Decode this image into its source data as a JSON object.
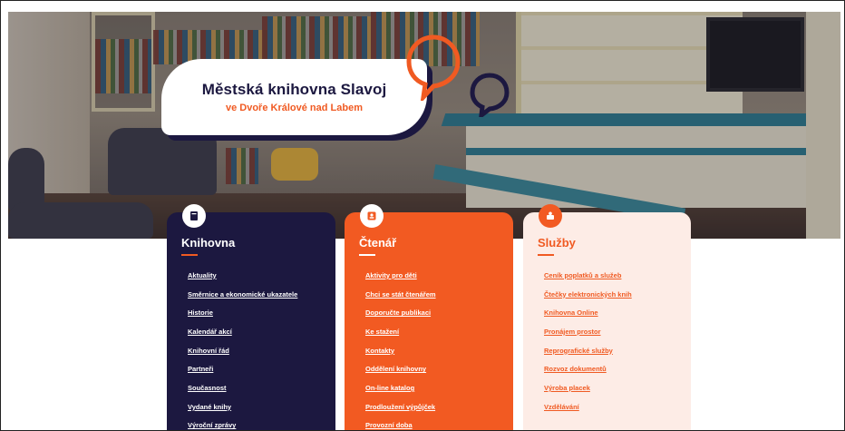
{
  "logo": {
    "title": "Městská knihovna Slavoj",
    "subtitle": "ve Dvoře Králové nad Labem"
  },
  "hero": {
    "image": "library-interior-photo"
  },
  "colors": {
    "navy": "#1c1840",
    "orange": "#f25a22",
    "peach": "#fdece6"
  },
  "sections": [
    {
      "title": "Knihovna",
      "icon": "book-icon",
      "links": [
        "Aktuality",
        "Směrnice a ekonomické ukazatele",
        "Historie",
        "Kalendář akcí",
        "Knihovní řád",
        "Partneři",
        "Současnost",
        "Vydané knihy",
        "Výroční zprávy"
      ]
    },
    {
      "title": "Čtenář",
      "icon": "reader-card-icon",
      "links": [
        "Aktivity pro děti",
        "Chci se stát čtenářem",
        "Doporučte publikaci",
        "Ke stažení",
        "Kontakty",
        "Oddělení knihovny",
        "On-line katalog",
        "Prodloužení výpůjček",
        "Provozní doba"
      ]
    },
    {
      "title": "Služby",
      "icon": "services-icon",
      "links": [
        "Ceník poplatků a služeb",
        "Čtečky elektronických knih",
        "Knihovna Online",
        "Pronájem prostor",
        "Reprografické služby",
        "Rozvoz dokumentů",
        "Výroba placek",
        "Vzdělávání"
      ]
    }
  ]
}
